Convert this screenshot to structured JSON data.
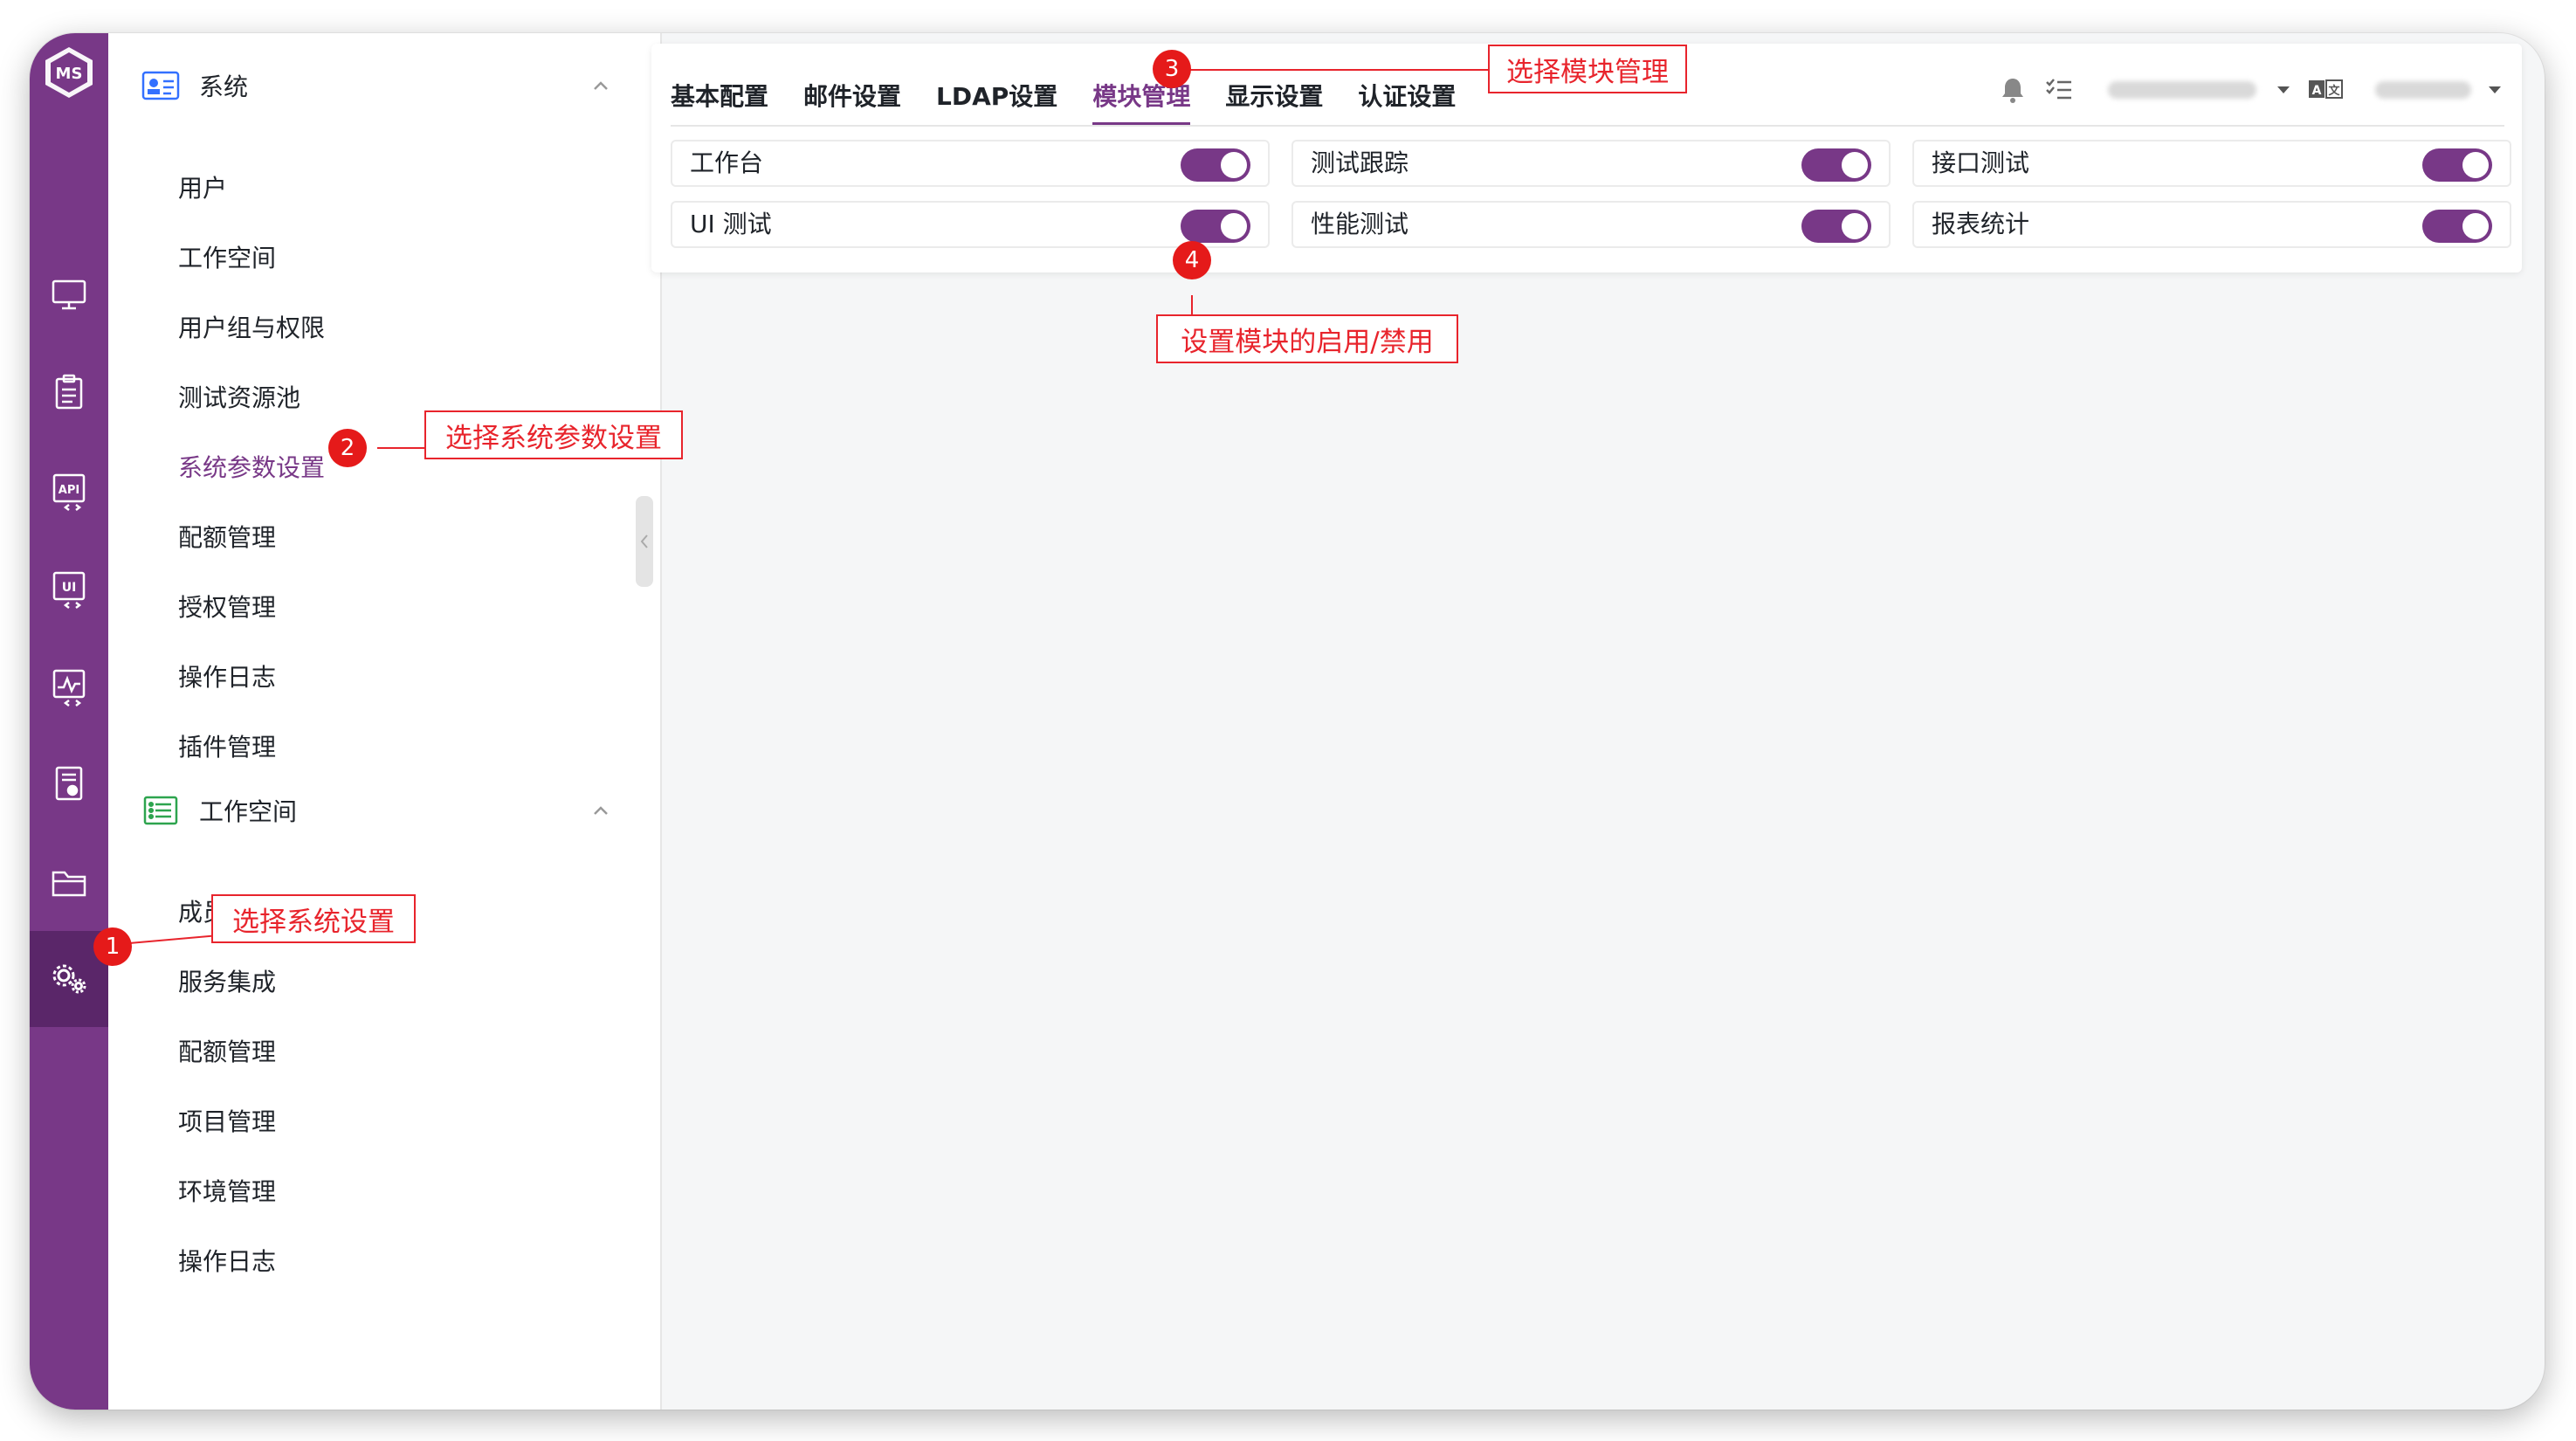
{
  "colors": {
    "brand": "#783887",
    "brand_dark": "#5a2669",
    "annotation": "#e8242c"
  },
  "rail": {
    "logo": "ms-logo",
    "icons": [
      "monitor-icon",
      "clipboard-icon",
      "api-icon",
      "ui-icon",
      "performance-icon",
      "report-icon",
      "folder-icon",
      "settings-icon"
    ],
    "active_index": 7
  },
  "sidebar": {
    "system": {
      "label": "系统",
      "items": [
        "用户",
        "工作空间",
        "用户组与权限",
        "测试资源池",
        "系统参数设置",
        "配额管理",
        "授权管理",
        "操作日志",
        "插件管理"
      ],
      "active_index": 4
    },
    "workspace": {
      "label": "工作空间",
      "items": [
        "成员",
        "服务集成",
        "配额管理",
        "项目管理",
        "环境管理",
        "操作日志"
      ]
    }
  },
  "main": {
    "tabs": [
      "基本配置",
      "邮件设置",
      "LDAP设置",
      "模块管理",
      "显示设置",
      "认证设置"
    ],
    "active_tab": 3,
    "modules": [
      {
        "label": "工作台",
        "enabled": true
      },
      {
        "label": "测试跟踪",
        "enabled": true
      },
      {
        "label": "接口测试",
        "enabled": true
      },
      {
        "label": "UI 测试",
        "enabled": true
      },
      {
        "label": "性能测试",
        "enabled": true
      },
      {
        "label": "报表统计",
        "enabled": true
      }
    ]
  },
  "header": {
    "icons": [
      "bell-icon",
      "task-list-icon",
      "language-icon"
    ]
  },
  "annotations": [
    {
      "num": "1",
      "text": "选择系统设置"
    },
    {
      "num": "2",
      "text": "选择系统参数设置"
    },
    {
      "num": "3",
      "text": "选择模块管理"
    },
    {
      "num": "4",
      "text": "设置模块的启用/禁用"
    }
  ]
}
